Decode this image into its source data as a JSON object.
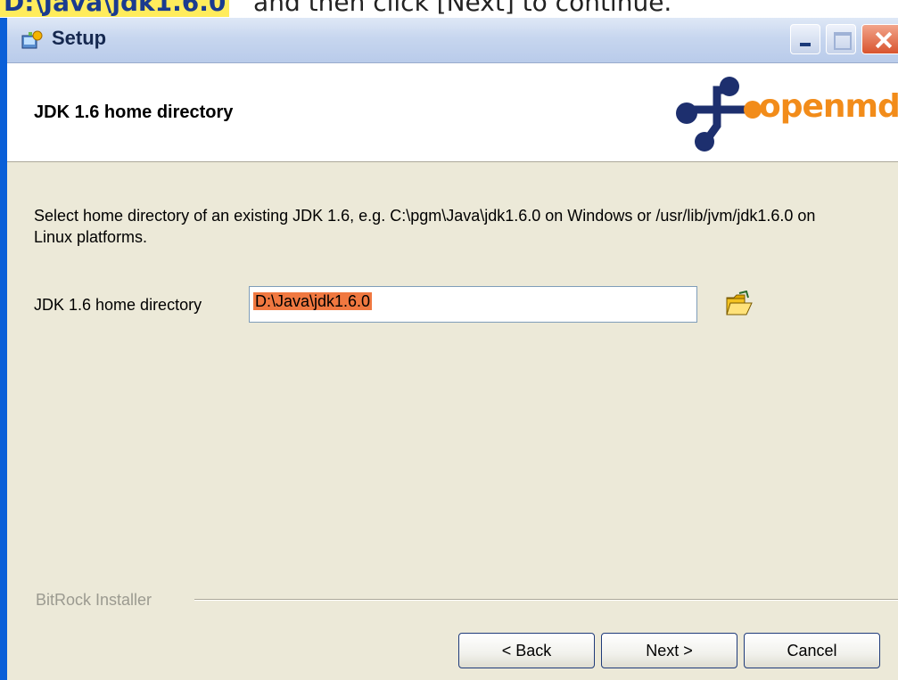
{
  "instruction": {
    "highlighted": "D:\\Java\\jdk1.6.0",
    "rest": "and then click [Next] to continue."
  },
  "window": {
    "title": "Setup",
    "icon": "setup-installer-icon"
  },
  "header": {
    "title": "JDK 1.6 home directory",
    "logo_text": "openmdx",
    "logo_color": "#f28c1a",
    "logo_mark_color": "#1d2f6e"
  },
  "main": {
    "description": "Select home directory of an existing JDK 1.6, e.g. C:\\pgm\\Java\\jdk1.6.0 on Windows or /usr/lib/jvm/jdk1.6.0 on Linux platforms.",
    "field_label": "JDK 1.6 home directory",
    "field_value": "D:\\Java\\jdk1.6.0",
    "field_selection_color": "#f07840",
    "browse_icon": "folder-open-icon"
  },
  "footer": {
    "brand": "BitRock Installer",
    "back_label": "< Back",
    "next_label": "Next >",
    "cancel_label": "Cancel"
  }
}
